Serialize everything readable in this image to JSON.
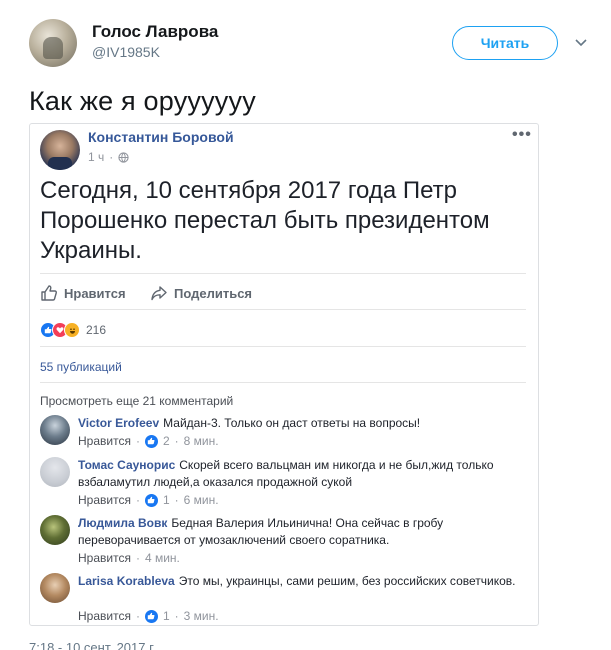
{
  "tweet": {
    "display_name": "Голос Лаврова",
    "handle": "@IV1985K",
    "follow_label": "Читать",
    "text": "Как же я оруууууу",
    "timestamp": "7:18 - 10 сент. 2017 г."
  },
  "fb_post": {
    "author": "Константин Боровой",
    "time": "1 ч",
    "more": "•••",
    "text": "Сегодня, 10 сентября 2017 года Петр Порошенко перестал быть президентом Украины.",
    "like_label": "Нравится",
    "share_label": "Поделиться",
    "reaction_count": "216",
    "shares_label": "55 публикаций",
    "more_comments_label": "Просмотреть еще 21 комментарий"
  },
  "comments": [
    {
      "author": "Victor Erofeev",
      "text": "Майдан-3. Только он даст ответы на вопросы!",
      "like_label": "Нравится",
      "likes": "2",
      "time": "8 мин."
    },
    {
      "author": "Томас Саунорис",
      "text": "Скорей всего вальцман им никогда и не был,жид только взбаламутил людей,а оказался продажной сукой",
      "like_label": "Нравится",
      "likes": "1",
      "time": "6 мин."
    },
    {
      "author": "Людмила Вовк",
      "text": "Бедная Валерия Ильинична! Она сейчас в гробу переворачивается от умозаключений своего соратника.",
      "like_label": "Нравится",
      "likes": "",
      "time": "4 мин."
    },
    {
      "author": "Larisa Korableva",
      "text": "Это мы, украинцы, сами решим, без российских советчиков.",
      "like_label": "Нравится",
      "likes": "1",
      "time": "3 мин."
    }
  ],
  "colors": {
    "twitter_blue": "#1da1f2",
    "fb_link": "#385898",
    "fb_like": "#1877f2"
  }
}
